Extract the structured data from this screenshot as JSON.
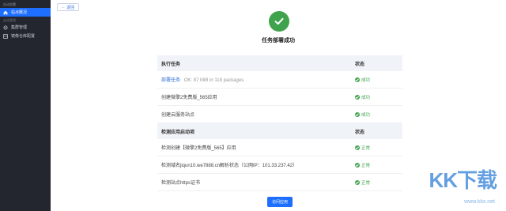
{
  "sidebar": {
    "header": "自动部署",
    "items": [
      {
        "label": "站点概况",
        "icon": "home-icon",
        "active": true
      },
      {
        "label": "集群管理",
        "icon": "cluster-icon",
        "active": false
      },
      {
        "label": "镜像仓库配置",
        "icon": "registry-icon",
        "active": false
      }
    ],
    "group_label": "自动管理"
  },
  "back_label": "返回",
  "title": "任务部署成功",
  "section1": {
    "col_task": "执行任务",
    "col_status": "状态",
    "rows": [
      {
        "name": "部署任务",
        "detail": "OK: 87 MiB in 118 packages",
        "status": "成功"
      },
      {
        "name": "创建微擎2免费版_565应用",
        "detail": "",
        "status": "成功"
      },
      {
        "name": "创建云服务站点",
        "detail": "",
        "status": "成功"
      }
    ]
  },
  "section2": {
    "col_task": "检测应用启动项",
    "col_status": "状态",
    "rows": [
      {
        "name": "检测创建【微擎2免费版_565】应用",
        "status": "正常"
      },
      {
        "name": "检测域名jiqun10.we7888.cn解析状态（公网IP：101.33.237.42）",
        "status": "正常"
      },
      {
        "name": "检测站点https证书",
        "status": "正常"
      }
    ]
  },
  "visit_button": "访问应用",
  "watermark": {
    "text": "KK下载",
    "url": "www.kkx.net"
  },
  "colors": {
    "accent": "#1e6fff",
    "success": "#3fa34d",
    "sidebar_bg": "#23262e"
  }
}
